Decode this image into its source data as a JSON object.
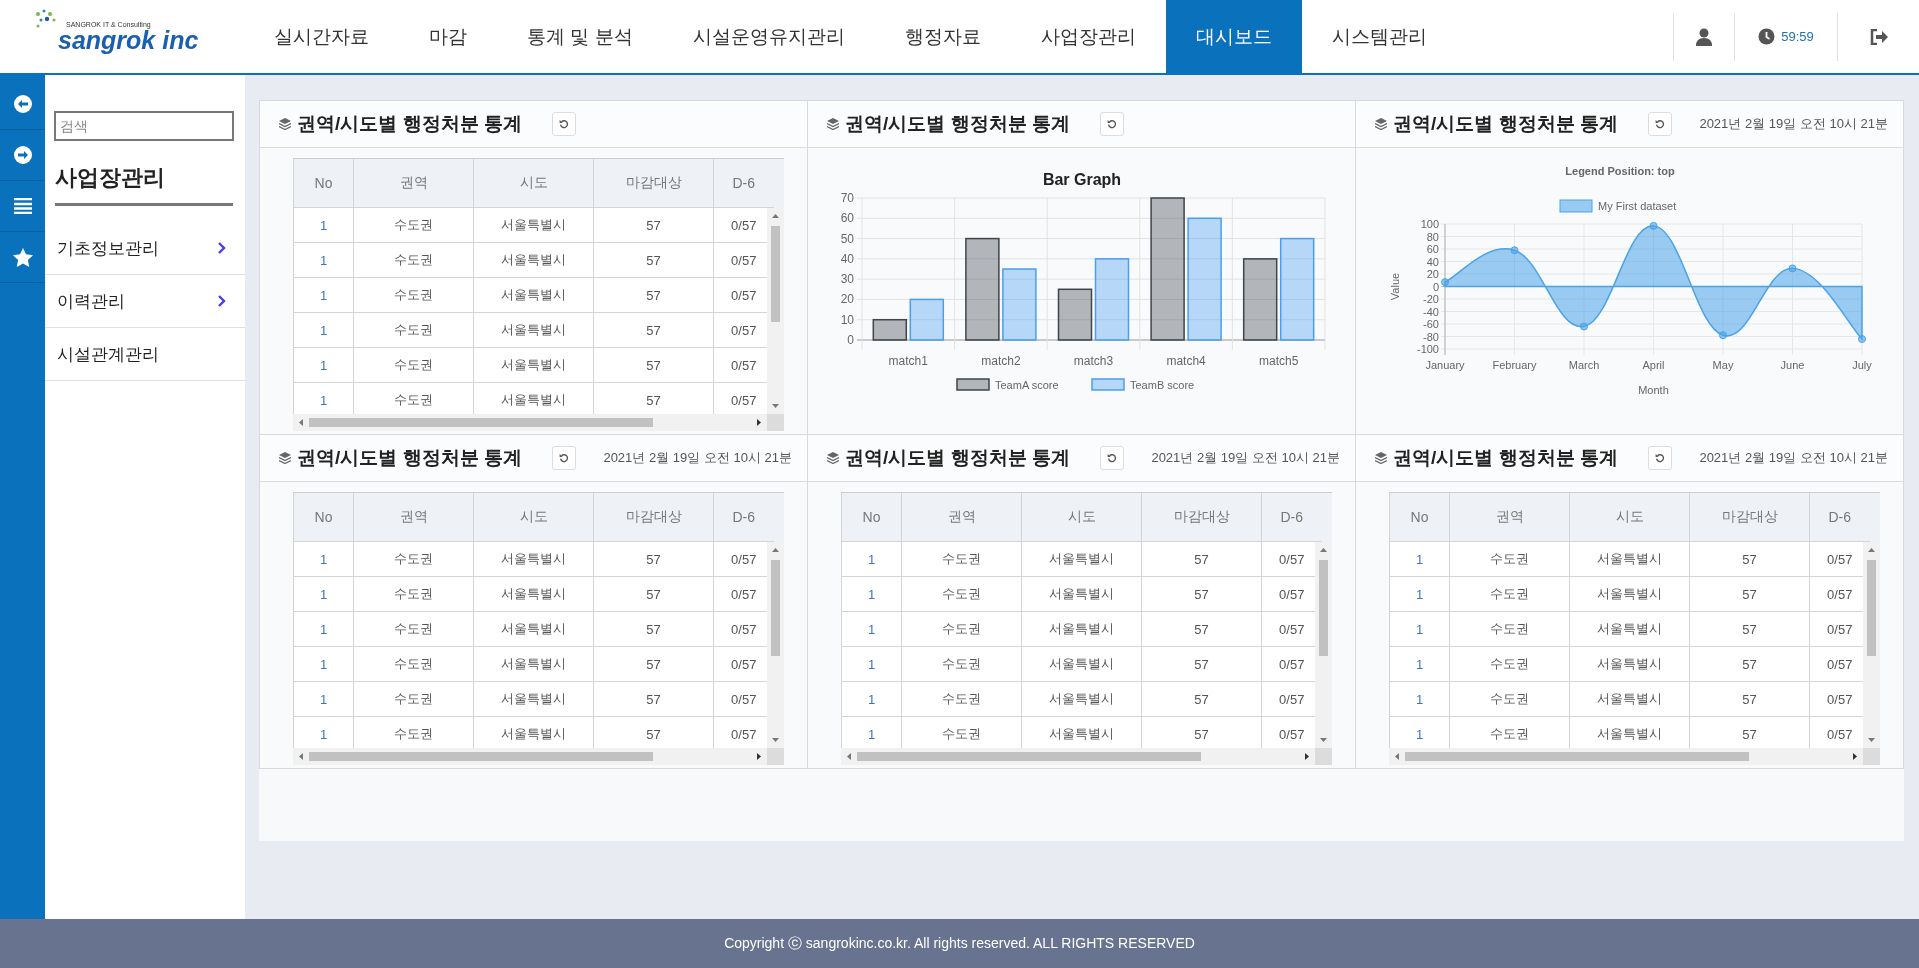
{
  "header": {
    "logo": {
      "tagline": "SANGROK IT & Consulting",
      "name": "sangrok inc"
    },
    "nav": [
      {
        "label": "실시간자료",
        "selected": false
      },
      {
        "label": "마감",
        "selected": false
      },
      {
        "label": "통계 및 분석",
        "selected": false
      },
      {
        "label": "시설운영유지관리",
        "selected": false
      },
      {
        "label": "행정자료",
        "selected": false
      },
      {
        "label": "사업장관리",
        "selected": false
      },
      {
        "label": "대시보드",
        "selected": true
      },
      {
        "label": "시스템관리",
        "selected": false
      }
    ],
    "timer": "59:59"
  },
  "sidebar": {
    "search": {
      "placeholder": "검색"
    },
    "title": "사업장관리",
    "items": [
      {
        "label": "기초정보관리",
        "has_submenu": true
      },
      {
        "label": "이력관리",
        "has_submenu": true
      },
      {
        "label": "시설관계관리",
        "has_submenu": false
      }
    ]
  },
  "panels": [
    {
      "kind": "table",
      "title": "권역/시도별 행정처분 통계",
      "table": {
        "columns": [
          "No",
          "권역",
          "시도",
          "마감대상",
          "D-6"
        ],
        "rows": [
          [
            "1",
            "수도권",
            "서울특별시",
            "57",
            "0/57"
          ],
          [
            "1",
            "수도권",
            "서울특별시",
            "57",
            "0/57"
          ],
          [
            "1",
            "수도권",
            "서울특별시",
            "57",
            "0/57"
          ],
          [
            "1",
            "수도권",
            "서울특별시",
            "57",
            "0/57"
          ],
          [
            "1",
            "수도권",
            "서울특별시",
            "57",
            "0/57"
          ],
          [
            "1",
            "수도권",
            "서울특별시",
            "57",
            "0/57"
          ]
        ]
      }
    },
    {
      "kind": "chart",
      "title": "권역/시도별 행정처분 통계",
      "chart_data": {
        "type": "bar",
        "title": "Bar Graph",
        "categories": [
          "match1",
          "match2",
          "match3",
          "match4",
          "match5"
        ],
        "series": [
          {
            "name": "TeamA score",
            "color": "#3f454b",
            "values": [
              10,
              50,
              25,
              70,
              40
            ]
          },
          {
            "name": "TeamB score",
            "color": "#4a9ff0",
            "values": [
              20,
              35,
              40,
              60,
              50
            ]
          }
        ],
        "ylim": [
          0,
          70
        ],
        "yticks": [
          0,
          10,
          20,
          30,
          40,
          50,
          60,
          70
        ],
        "grid": true,
        "legend": true
      }
    },
    {
      "kind": "chart",
      "title": "권역/시도별 행정처분 통계",
      "date": "2021년 2월 19일 오전 10시 21분",
      "chart_data": {
        "type": "area",
        "title": "Legend Position: top",
        "xlabel": "Month",
        "ylabel": "Value",
        "categories": [
          "January",
          "February",
          "March",
          "April",
          "May",
          "June",
          "July"
        ],
        "series": [
          {
            "name": "My First dataset",
            "color": "#4aa3e8",
            "values": [
              7,
              58,
              -64,
              97,
              -78,
              29,
              -84
            ]
          }
        ],
        "ylim": [
          -100,
          100
        ],
        "yticks": [
          -100,
          -80,
          -60,
          -40,
          -20,
          0,
          20,
          40,
          60,
          80,
          100
        ],
        "grid": true,
        "legend": true
      }
    },
    {
      "kind": "table",
      "title": "권역/시도별 행정처분 통계",
      "date": "2021년 2월 19일 오전 10시 21분",
      "table": {
        "columns": [
          "No",
          "권역",
          "시도",
          "마감대상",
          "D-6"
        ],
        "rows": [
          [
            "1",
            "수도권",
            "서울특별시",
            "57",
            "0/57"
          ],
          [
            "1",
            "수도권",
            "서울특별시",
            "57",
            "0/57"
          ],
          [
            "1",
            "수도권",
            "서울특별시",
            "57",
            "0/57"
          ],
          [
            "1",
            "수도권",
            "서울특별시",
            "57",
            "0/57"
          ],
          [
            "1",
            "수도권",
            "서울특별시",
            "57",
            "0/57"
          ],
          [
            "1",
            "수도권",
            "서울특별시",
            "57",
            "0/57"
          ]
        ]
      }
    },
    {
      "kind": "table",
      "title": "권역/시도별 행정처분 통계",
      "date": "2021년 2월 19일 오전 10시 21분",
      "table": {
        "columns": [
          "No",
          "권역",
          "시도",
          "마감대상",
          "D-6"
        ],
        "rows": [
          [
            "1",
            "수도권",
            "서울특별시",
            "57",
            "0/57"
          ],
          [
            "1",
            "수도권",
            "서울특별시",
            "57",
            "0/57"
          ],
          [
            "1",
            "수도권",
            "서울특별시",
            "57",
            "0/57"
          ],
          [
            "1",
            "수도권",
            "서울특별시",
            "57",
            "0/57"
          ],
          [
            "1",
            "수도권",
            "서울특별시",
            "57",
            "0/57"
          ],
          [
            "1",
            "수도권",
            "서울특별시",
            "57",
            "0/57"
          ]
        ]
      }
    },
    {
      "kind": "table",
      "title": "권역/시도별 행정처분 통계",
      "date": "2021년 2월 19일 오전 10시 21분",
      "table": {
        "columns": [
          "No",
          "권역",
          "시도",
          "마감대상",
          "D-6"
        ],
        "rows": [
          [
            "1",
            "수도권",
            "서울특별시",
            "57",
            "0/57"
          ],
          [
            "1",
            "수도권",
            "서울특별시",
            "57",
            "0/57"
          ],
          [
            "1",
            "수도권",
            "서울특별시",
            "57",
            "0/57"
          ],
          [
            "1",
            "수도권",
            "서울특별시",
            "57",
            "0/57"
          ],
          [
            "1",
            "수도권",
            "서울특별시",
            "57",
            "0/57"
          ],
          [
            "1",
            "수도권",
            "서울특별시",
            "57",
            "0/57"
          ]
        ]
      }
    }
  ],
  "footer": "Copyright ⓒ sangrokinc.co.kr. All rights reserved. ALL RIGHTS RESERVED"
}
